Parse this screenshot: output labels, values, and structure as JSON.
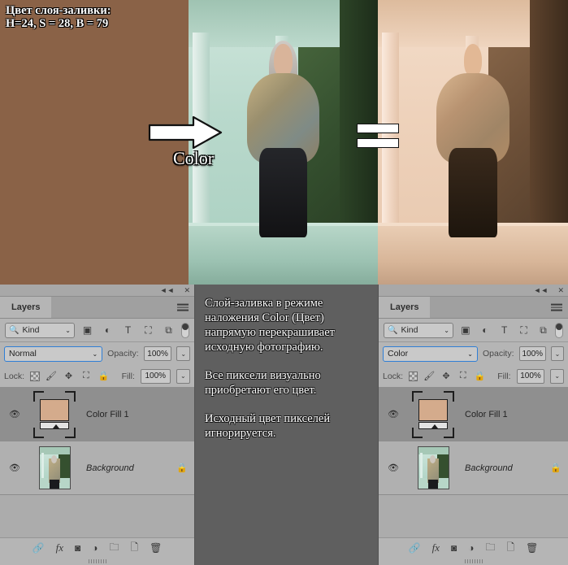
{
  "overlay": {
    "fill_caption": "Цвет слоя-заливки:\nH=24, S = 28, B = 79",
    "arrow_label": "Color",
    "arrow_icon": "right-arrow-icon",
    "equals_icon": "equals-badge-icon",
    "fill_color": "#8a6247",
    "swatch_color": "#d4ab8c"
  },
  "note": {
    "paragraphs": [
      "Слой-заливка в режиме наложения Color (Цвет) напрямую перекрашивает исходную фотографию.",
      "Все пиксели визуально приобретают его цвет.",
      "Исходный цвет пикселей игнорируется."
    ]
  },
  "panel_left": {
    "titlebar": {
      "collapse_icon": "collapse-icon",
      "collapse_glyph": "◄◄",
      "close_icon": "close-icon",
      "close_glyph": "✕"
    },
    "tab_label": "Layers",
    "menu_icon": "hamburger-menu-icon",
    "filter": {
      "kind_label": "Kind",
      "search_icon": "search-icon",
      "chevron": "⌄",
      "icons": [
        "pixel-layer-filter-icon",
        "adjustment-layer-filter-icon",
        "type-layer-filter-icon",
        "shape-layer-filter-icon",
        "smart-object-filter-icon"
      ],
      "glyphs": [
        "▣",
        "◐",
        "T",
        "⛶",
        "⧉"
      ],
      "toggle_icon": "filter-enable-toggle"
    },
    "blend": {
      "mode": "Normal",
      "chevron": "⌄",
      "opacity_label": "Opacity:",
      "opacity_value": "100%"
    },
    "lock": {
      "label": "Lock:",
      "icons": [
        "lock-transparent-pixels-icon",
        "lock-image-pixels-icon",
        "lock-position-icon",
        "lock-artboard-icon",
        "lock-all-icon"
      ],
      "glyphs": [
        "▨",
        "🖌",
        "✥",
        "⛶",
        "🔒"
      ],
      "fill_label": "Fill:",
      "fill_value": "100%"
    },
    "layers": [
      {
        "name": "Color Fill 1",
        "selected": true,
        "locked": false,
        "italic": false,
        "visible": true,
        "thumb": "color-fill-thumbnail"
      },
      {
        "name": "Background",
        "selected": false,
        "locked": true,
        "italic": true,
        "visible": true,
        "thumb": "photo-thumbnail"
      }
    ],
    "toolbar": {
      "icons": [
        "link-layers-icon",
        "layer-style-fx-icon",
        "add-layer-mask-icon",
        "new-adjustment-layer-icon",
        "new-group-icon",
        "new-layer-icon",
        "delete-layer-icon"
      ],
      "glyphs": [
        "🔗",
        "fx",
        "◙",
        "◑",
        "🗀",
        "🗋",
        "🗑"
      ]
    }
  },
  "panel_right": {
    "titlebar": {
      "collapse_icon": "collapse-icon",
      "collapse_glyph": "◄◄",
      "close_icon": "close-icon",
      "close_glyph": "✕"
    },
    "tab_label": "Layers",
    "menu_icon": "hamburger-menu-icon",
    "filter": {
      "kind_label": "Kind",
      "search_icon": "search-icon",
      "chevron": "⌄",
      "glyphs": [
        "▣",
        "◐",
        "T",
        "⛶",
        "⧉"
      ]
    },
    "blend": {
      "mode": "Color",
      "chevron": "⌄",
      "opacity_label": "Opacity:",
      "opacity_value": "100%"
    },
    "lock": {
      "label": "Lock:",
      "glyphs": [
        "▨",
        "🖌",
        "✥",
        "⛶",
        "🔒"
      ],
      "fill_label": "Fill:",
      "fill_value": "100%"
    },
    "layers": [
      {
        "name": "Color Fill 1",
        "selected": true,
        "locked": false,
        "italic": false,
        "visible": true
      },
      {
        "name": "Background",
        "selected": false,
        "locked": true,
        "italic": true,
        "visible": true
      }
    ],
    "toolbar": {
      "glyphs": [
        "🔗",
        "fx",
        "◙",
        "◑",
        "🗀",
        "🗋",
        "🗑"
      ]
    }
  }
}
